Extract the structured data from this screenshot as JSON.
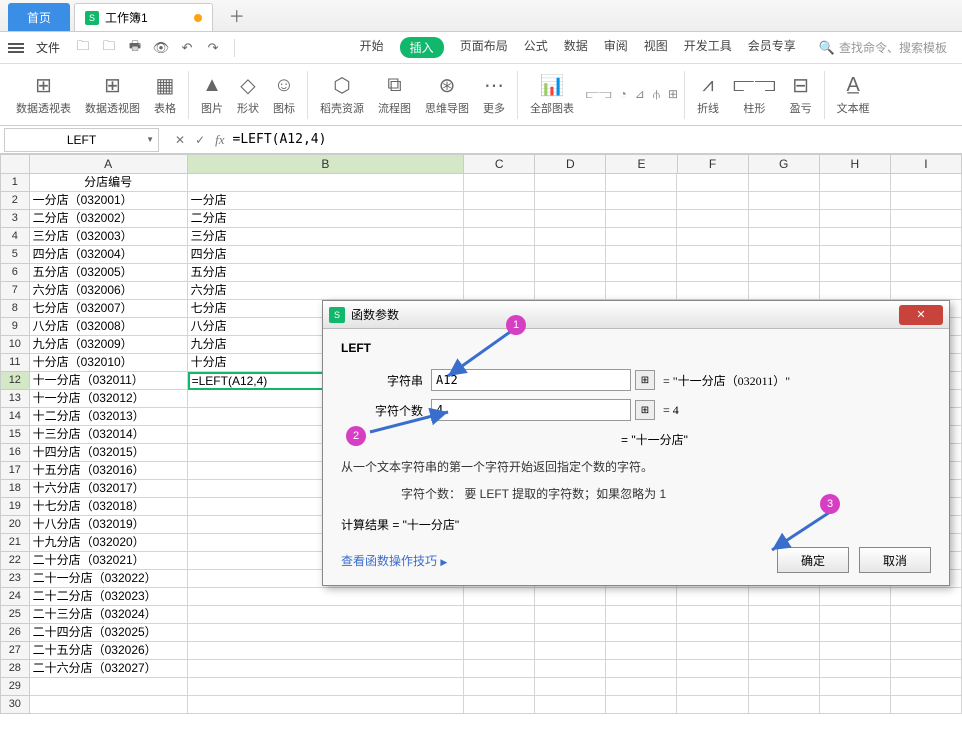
{
  "tabbar": {
    "home": "首页",
    "doc": "工作簿1"
  },
  "menubar": {
    "file": "文件"
  },
  "menus": {
    "start": "开始",
    "insert": "插入",
    "layout": "页面布局",
    "formula": "公式",
    "data": "数据",
    "review": "审阅",
    "view": "视图",
    "dev": "开发工具",
    "member": "会员专享"
  },
  "search": {
    "placeholder": "查找命令、搜索模板"
  },
  "ribbon": {
    "pivottable": "数据透视表",
    "pivotchart": "数据透视图",
    "table": "表格",
    "picture": "图片",
    "shape": "形状",
    "icon": "图标",
    "docer": "稻壳资源",
    "flow": "流程图",
    "mindmap": "思维导图",
    "more": "更多",
    "allcharts": "全部图表",
    "line": "折线",
    "column": "柱形",
    "winloss": "盈亏",
    "textbox": "文本框"
  },
  "namebox": "LEFT",
  "formula": "=LEFT(A12,4)",
  "colA_header": "分店编号",
  "rows": [
    {
      "a": "一分店（032001）",
      "b": "一分店"
    },
    {
      "a": "二分店（032002）",
      "b": "二分店"
    },
    {
      "a": "三分店（032003）",
      "b": "三分店"
    },
    {
      "a": "四分店（032004）",
      "b": "四分店"
    },
    {
      "a": "五分店（032005）",
      "b": "五分店"
    },
    {
      "a": "六分店（032006）",
      "b": "六分店"
    },
    {
      "a": "七分店（032007）",
      "b": "七分店"
    },
    {
      "a": "八分店（032008）",
      "b": "八分店"
    },
    {
      "a": "九分店（032009）",
      "b": "九分店"
    },
    {
      "a": "十分店（032010）",
      "b": "十分店"
    },
    {
      "a": "十一分店（032011）",
      "b": "=LEFT(A12,4)"
    },
    {
      "a": "十一分店（032012）",
      "b": ""
    },
    {
      "a": "十二分店（032013）",
      "b": ""
    },
    {
      "a": "十三分店（032014）",
      "b": ""
    },
    {
      "a": "十四分店（032015）",
      "b": ""
    },
    {
      "a": "十五分店（032016）",
      "b": ""
    },
    {
      "a": "十六分店（032017）",
      "b": ""
    },
    {
      "a": "十七分店（032018）",
      "b": ""
    },
    {
      "a": "十八分店（032019）",
      "b": ""
    },
    {
      "a": "十九分店（032020）",
      "b": ""
    },
    {
      "a": "二十分店（032021）",
      "b": ""
    },
    {
      "a": "二十一分店（032022）",
      "b": ""
    },
    {
      "a": "二十二分店（032023）",
      "b": ""
    },
    {
      "a": "二十三分店（032024）",
      "b": ""
    },
    {
      "a": "二十四分店（032025）",
      "b": ""
    },
    {
      "a": "二十五分店（032026）",
      "b": ""
    },
    {
      "a": "二十六分店（032027）",
      "b": ""
    }
  ],
  "dialog": {
    "title": "函数参数",
    "fn": "LEFT",
    "p1_label": "字符串",
    "p1_value": "A12",
    "p1_result": "= \"十一分店（032011）\"",
    "p2_label": "字符个数",
    "p2_value": "4",
    "p2_result": "= 4",
    "preview": "= \"十一分店\"",
    "desc": "从一个文本字符串的第一个字符开始返回指定个数的字符。",
    "subdesc": "字符个数： 要 LEFT 提取的字符数；如果忽略为 1",
    "calc": "计算结果 = \"十一分店\"",
    "link": "查看函数操作技巧",
    "link_icon": "▶",
    "ok": "确定",
    "cancel": "取消"
  },
  "callouts": {
    "c1": "1",
    "c2": "2",
    "c3": "3"
  }
}
